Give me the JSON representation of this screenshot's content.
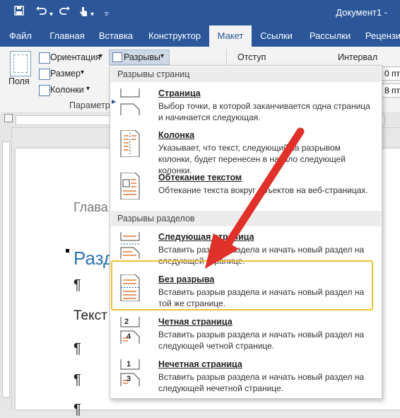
{
  "titlebar": {
    "save_icon": "save-icon",
    "undo_icon": "undo-icon",
    "redo_icon": "redo-icon",
    "touch_icon": "touch-mode-icon",
    "customize_icon": "customize-qat-icon",
    "document_title": "Документ1 -"
  },
  "tabs": [
    "Файл",
    "Главная",
    "Вставка",
    "Конструктор",
    "Макет",
    "Ссылки",
    "Рассылки",
    "Рецензи"
  ],
  "active_tab": "Макет",
  "ribbon": {
    "fields_label": "Поля",
    "orientation_label": "Ориентация",
    "orientation_caret": "▾",
    "breaks_label": "Разрывы",
    "breaks_caret": "▾",
    "size_label": "Размер",
    "size_caret": "▾",
    "columns_label": "Колонки",
    "columns_caret": "▾",
    "group_label": "Параметры",
    "indent_label": "Отступ",
    "spacing_label": "Интервал",
    "spacing_before": "0 пт",
    "spacing_after": "8 пт"
  },
  "document": {
    "heading_gray": "Глава",
    "heading_blue": "Разд",
    "pilcrow": "¶",
    "body_text": "Текст"
  },
  "dropdown": {
    "page_breaks_header": "Разрывы страниц",
    "section_breaks_header": "Разрывы разделов",
    "items": [
      {
        "title": "Страница",
        "desc": "Выбор точки, в которой заканчивается одна страница и начинается следующая.",
        "icon": "page-break-icon"
      },
      {
        "title": "Колонка",
        "desc": "Указывает, что текст, следующий за разрывом колонки, будет перенесен в начало следующей колонки.",
        "icon": "column-break-icon"
      },
      {
        "title": "Обтекание текстом",
        "desc": "Обтекание текста вокруг объектов на веб-страницах.",
        "icon": "text-wrapping-break-icon"
      },
      {
        "title": "Следующая страница",
        "desc": "Вставить разрыв раздела и начать новый раздел на следующей странице.",
        "icon": "next-page-section-icon"
      },
      {
        "title": "Без разрыва",
        "desc": "Вставить разрыв раздела и начать новый раздел на той же странице.",
        "icon": "continuous-section-icon"
      },
      {
        "title": "Четная страница",
        "desc": "Вставить разрыв раздела и начать новый раздел на следующей четной странице.",
        "icon": "even-page-section-icon",
        "badges": [
          "2",
          "4"
        ]
      },
      {
        "title": "Нечетная страница",
        "desc": "Вставить разрыв раздела и начать новый раздел на следующей нечетной странице.",
        "icon": "odd-page-section-icon",
        "badges": [
          "1",
          "3"
        ]
      }
    ]
  },
  "annotation": {
    "arrow_color": "#e0302a",
    "highlight_color": "#f2c230"
  }
}
